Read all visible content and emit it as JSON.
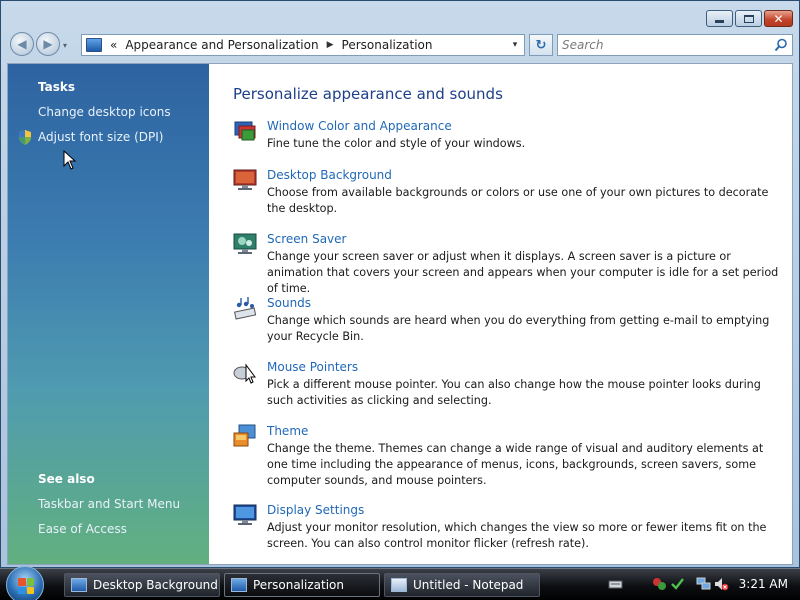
{
  "window": {
    "caption": {
      "minimize": "–",
      "maximize": "□",
      "close": "✕"
    }
  },
  "nav": {
    "breadcrumb_overflow": "«",
    "breadcrumb": [
      "Appearance and Personalization",
      "Personalization"
    ],
    "breadcrumb_sep": "▶",
    "dropdown_glyph": "▾",
    "refresh_glyph": "↻",
    "search_placeholder": "Search"
  },
  "left_pane": {
    "tasks_heading": "Tasks",
    "tasks": [
      {
        "label": "Change desktop icons"
      },
      {
        "label": "Adjust font size (DPI)"
      }
    ],
    "see_also_heading": "See also",
    "see_also": [
      {
        "label": "Taskbar and Start Menu"
      },
      {
        "label": "Ease of Access"
      }
    ]
  },
  "main": {
    "title": "Personalize appearance and sounds",
    "items": [
      {
        "icon": "window-color-icon",
        "label": "Window Color and Appearance",
        "desc": "Fine tune the color and style of your windows."
      },
      {
        "icon": "desktop-background-icon",
        "label": "Desktop Background",
        "desc": "Choose from available backgrounds or colors or use one of your own pictures to decorate the desktop."
      },
      {
        "icon": "screen-saver-icon",
        "label": "Screen Saver",
        "desc": "Change your screen saver or adjust when it displays. A screen saver is a picture or animation that covers your screen and appears when your computer is idle for a set period of time."
      },
      {
        "icon": "sounds-icon",
        "label": "Sounds",
        "desc": "Change which sounds are heard when you do everything from getting e-mail to emptying your Recycle Bin."
      },
      {
        "icon": "mouse-pointer-icon",
        "label": "Mouse Pointers",
        "desc": "Pick a different mouse pointer. You can also change how the mouse pointer looks during such activities as clicking and selecting."
      },
      {
        "icon": "theme-icon",
        "label": "Theme",
        "desc": "Change the theme. Themes can change a wide range of visual and auditory elements at one time including the appearance of menus, icons, backgrounds, screen savers, some computer sounds, and mouse pointers."
      },
      {
        "icon": "display-settings-icon",
        "label": "Display Settings",
        "desc": "Adjust your monitor resolution, which changes the view so more or fewer items fit on the screen. You can also control monitor flicker (refresh rate)."
      }
    ]
  },
  "taskbar": {
    "buttons": [
      {
        "label": "Desktop Background",
        "active": false
      },
      {
        "label": "Personalization",
        "active": true
      },
      {
        "label": "Untitled - Notepad",
        "active": false
      }
    ],
    "clock": "3:21 AM"
  },
  "colors": {
    "link": "#1f68b8",
    "title": "#1e3f8a",
    "left_pane_top": "#2d63a1",
    "left_pane_bottom": "#62b07f"
  }
}
